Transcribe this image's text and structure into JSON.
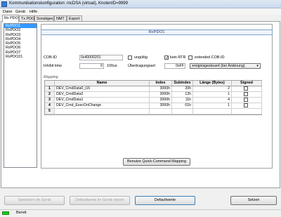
{
  "window": {
    "title": "Kommunikationskonfiguration: mcDSA (virtual), KnotenID=9999"
  },
  "menu": {
    "items": [
      "Datei",
      "Gerät",
      "Hilfe"
    ]
  },
  "tabs": [
    "Rx PDO",
    "Tx PDO",
    "Sonstiges",
    "NMT",
    "Export"
  ],
  "pdo_list": [
    "RxPDO1",
    "RxPDO2",
    "RxPDO3",
    "RxPDO4",
    "RxPDO5",
    "RxPDO6",
    "RxPDO7",
    "RxPDO21"
  ],
  "selected_pdo": "RxPDO1",
  "panel": {
    "header": "RxPDO1",
    "cob_label": "COB-ID",
    "cob_value": "0x40000201",
    "ungueltig_label": "ungültig",
    "kein_rtr_label": "kein RTR",
    "extended_label": "extended COB-ID",
    "inhibit_label": "Inhibit time",
    "inhibit_value": "0",
    "inhibit_unit": "100us",
    "uebertragung_label": "Übertragungsart",
    "uebertragung_value": "0xFF",
    "uebertragung_select": "ereignisgesteuert (bei Änderung)",
    "mapping_label": "Mapping"
  },
  "mapping_table": {
    "columns": [
      "Name",
      "Index",
      "Subindex",
      "Länge (Bytes)",
      "Signed"
    ],
    "rows": [
      {
        "n": "1",
        "name": "DEV_CmdData0_i16",
        "index": "3000h",
        "sub": "20h",
        "len": "2"
      },
      {
        "n": "2",
        "name": "DEV_CmdData2",
        "index": "3000h",
        "sub": "12h",
        "len": "1"
      },
      {
        "n": "3",
        "name": "DEV_CmdData1",
        "index": "3000h",
        "sub": "11h",
        "len": "4"
      },
      {
        "n": "4",
        "name": "DEV_Cmd_ExecOnChange",
        "index": "3000h",
        "sub": "01h",
        "len": "1"
      },
      {
        "n": "5",
        "name": "",
        "index": "",
        "sub": "",
        "len": ""
      }
    ]
  },
  "buttons": {
    "quick_cmd": "Benutze Quick-Command Mapping",
    "save": "Speichern im Gerät",
    "defaults_device": "Defaultwerte im Gerät setzen",
    "defaults": "Defaultwerte",
    "set": "Setzen"
  },
  "status": {
    "text": "Bereit",
    "color": "#22c322"
  }
}
